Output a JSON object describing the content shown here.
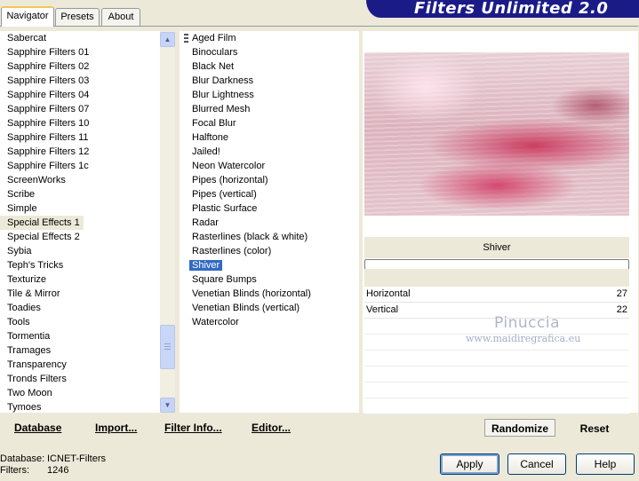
{
  "tabs": [
    "Navigator",
    "Presets",
    "About"
  ],
  "app_title": "Filters Unlimited 2.0",
  "categories": [
    "Sabercat",
    "Sapphire Filters 01",
    "Sapphire Filters 02",
    "Sapphire Filters 03",
    "Sapphire Filters 04",
    "Sapphire Filters 07",
    "Sapphire Filters 10",
    "Sapphire Filters 11",
    "Sapphire Filters 12",
    "Sapphire Filters 1c",
    "ScreenWorks",
    "Scribe",
    "Simple",
    "Special Effects 1",
    "Special Effects 2",
    "Sybia",
    "Teph's Tricks",
    "Texturize",
    "Tile & Mirror",
    "Toadies",
    "Tools",
    "Tormentia",
    "Tramages",
    "Transparency",
    "Tronds Filters",
    "Two Moon",
    "Tymoes"
  ],
  "selected_category": "Special Effects 1",
  "filters": [
    "Aged Film",
    "Binoculars",
    "Black Net",
    "Blur Darkness",
    "Blur Lightness",
    "Blurred Mesh",
    "Focal Blur",
    "Halftone",
    "Jailed!",
    "Neon Watercolor",
    "Pipes (horizontal)",
    "Pipes (vertical)",
    "Plastic Surface",
    "Radar",
    "Rasterlines (black & white)",
    "Rasterlines (color)",
    "Shiver",
    "Square Bumps",
    "Venetian Blinds (horizontal)",
    "Venetian Blinds (vertical)",
    "Watercolor"
  ],
  "selected_filter": "Shiver",
  "filter_name": "Shiver",
  "params": [
    {
      "label": "Horizontal",
      "value": "27"
    },
    {
      "label": "Vertical",
      "value": "22"
    }
  ],
  "watermark": {
    "name": "Pinuccia",
    "site": "www.maidiregrafica.eu"
  },
  "bottom_links": {
    "database": "Database",
    "import": "Import...",
    "filter_info": "Filter Info...",
    "editor": "Editor..."
  },
  "buttons": {
    "randomize": "Randomize",
    "reset": "Reset",
    "apply": "Apply",
    "cancel": "Cancel",
    "help": "Help"
  },
  "status": {
    "database_label": "Database:",
    "database_value": "ICNET-Filters",
    "filters_label": "Filters:",
    "filters_value": "1246"
  },
  "colors": {
    "selection": "#316ac5",
    "banner": "#1b1b88",
    "background": "#ece9d8"
  },
  "icons": {
    "scroll_up": "chevron-up-icon",
    "scroll_down": "chevron-down-icon"
  }
}
